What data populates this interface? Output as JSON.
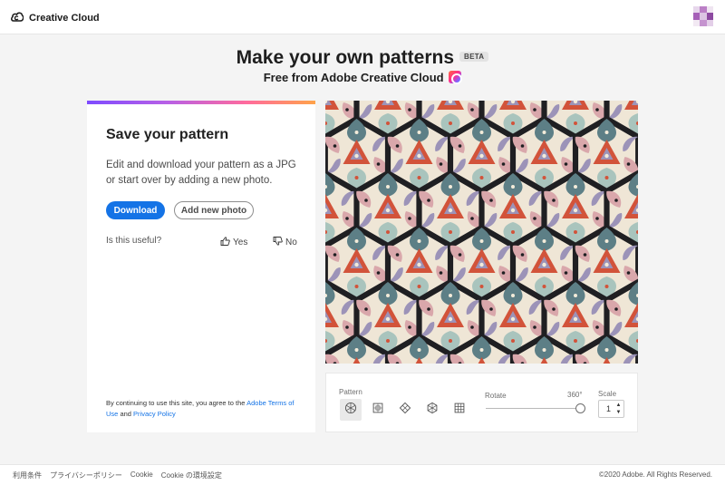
{
  "header": {
    "brand": "Creative Cloud",
    "brand_icon": "adobe-cc-logo-icon",
    "avatar_icon": "user-avatar-icon"
  },
  "hero": {
    "title": "Make your own patterns",
    "badge": "BETA",
    "subtitle": "Free from Adobe Creative Cloud",
    "subtitle_icon": "creative-cloud-app-icon"
  },
  "card": {
    "title": "Save your pattern",
    "description": "Edit and download your pattern as a JPG or start over by adding a new photo.",
    "download_label": "Download",
    "add_photo_label": "Add new photo",
    "useful_question": "Is this useful?",
    "yes_label": "Yes",
    "no_label": "No",
    "terms_prefix": "By continuing to use this site, you agree to the",
    "terms_link": "Adobe Terms of Use",
    "terms_and": "and",
    "privacy_link": "Privacy Policy",
    "accent_colors": [
      "#7e4bff",
      "#b760e6",
      "#ff6b9c",
      "#ffa34a"
    ]
  },
  "pattern_colors": {
    "background": "#efe6d6",
    "red": "#d2533a",
    "teal": "#5d7f86",
    "mint": "#a9c4bd",
    "dark": "#1f1f22",
    "pink": "#d9a7ab",
    "lilac": "#9c93b8",
    "cream": "#f3ebd9"
  },
  "controls": {
    "pattern_label": "Pattern",
    "pattern_options": [
      "hexagon-kaleidoscope",
      "square-grid-ornament",
      "diamond-mirror",
      "hexagon-star",
      "grid-tile"
    ],
    "selected_pattern": 0,
    "rotate_label": "Rotate",
    "rotate_value": "360°",
    "scale_label": "Scale",
    "scale_value": "1"
  },
  "footer": {
    "links": [
      "利用条件",
      "プライバシーポリシー",
      "Cookie",
      "Cookie の環境設定"
    ],
    "copyright": "©2020 Adobe. All Rights Reserved."
  },
  "colors": {
    "primary": "#1473e6",
    "page_bg": "#f4f4f4"
  }
}
